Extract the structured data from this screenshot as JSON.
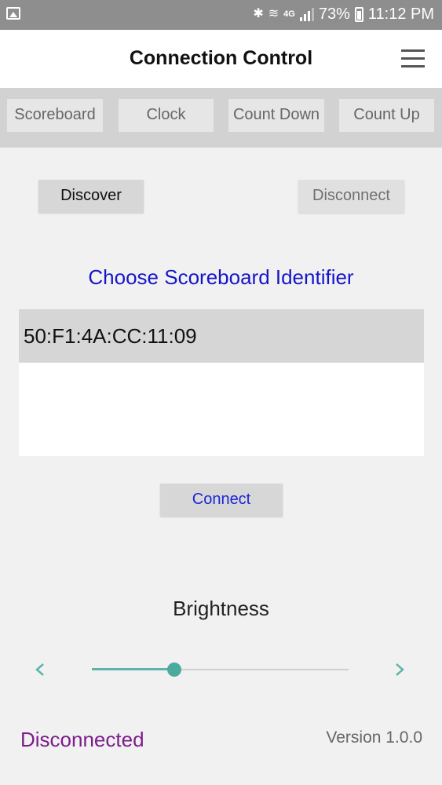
{
  "statusbar": {
    "network": "4G",
    "battery": "73%",
    "time": "11:12 PM",
    "signal_level": 0.6
  },
  "header": {
    "title": "Connection Control"
  },
  "tabs": [
    {
      "label": "Scoreboard"
    },
    {
      "label": "Clock"
    },
    {
      "label": "Count Down"
    },
    {
      "label": "Count Up"
    }
  ],
  "actions": {
    "discover_label": "Discover",
    "disconnect_label": "Disconnect"
  },
  "identifier": {
    "heading": "Choose Scoreboard Identifier",
    "items": [
      "50:F1:4A:CC:11:09"
    ]
  },
  "connect_label": "Connect",
  "brightness": {
    "label": "Brightness",
    "value": 0.32
  },
  "footer": {
    "connection_status": "Disconnected",
    "version": "Version 1.0.0"
  },
  "colors": {
    "accent": "#4aab9c",
    "link_blue": "#1515c8",
    "status_purple": "#7a1f88"
  }
}
